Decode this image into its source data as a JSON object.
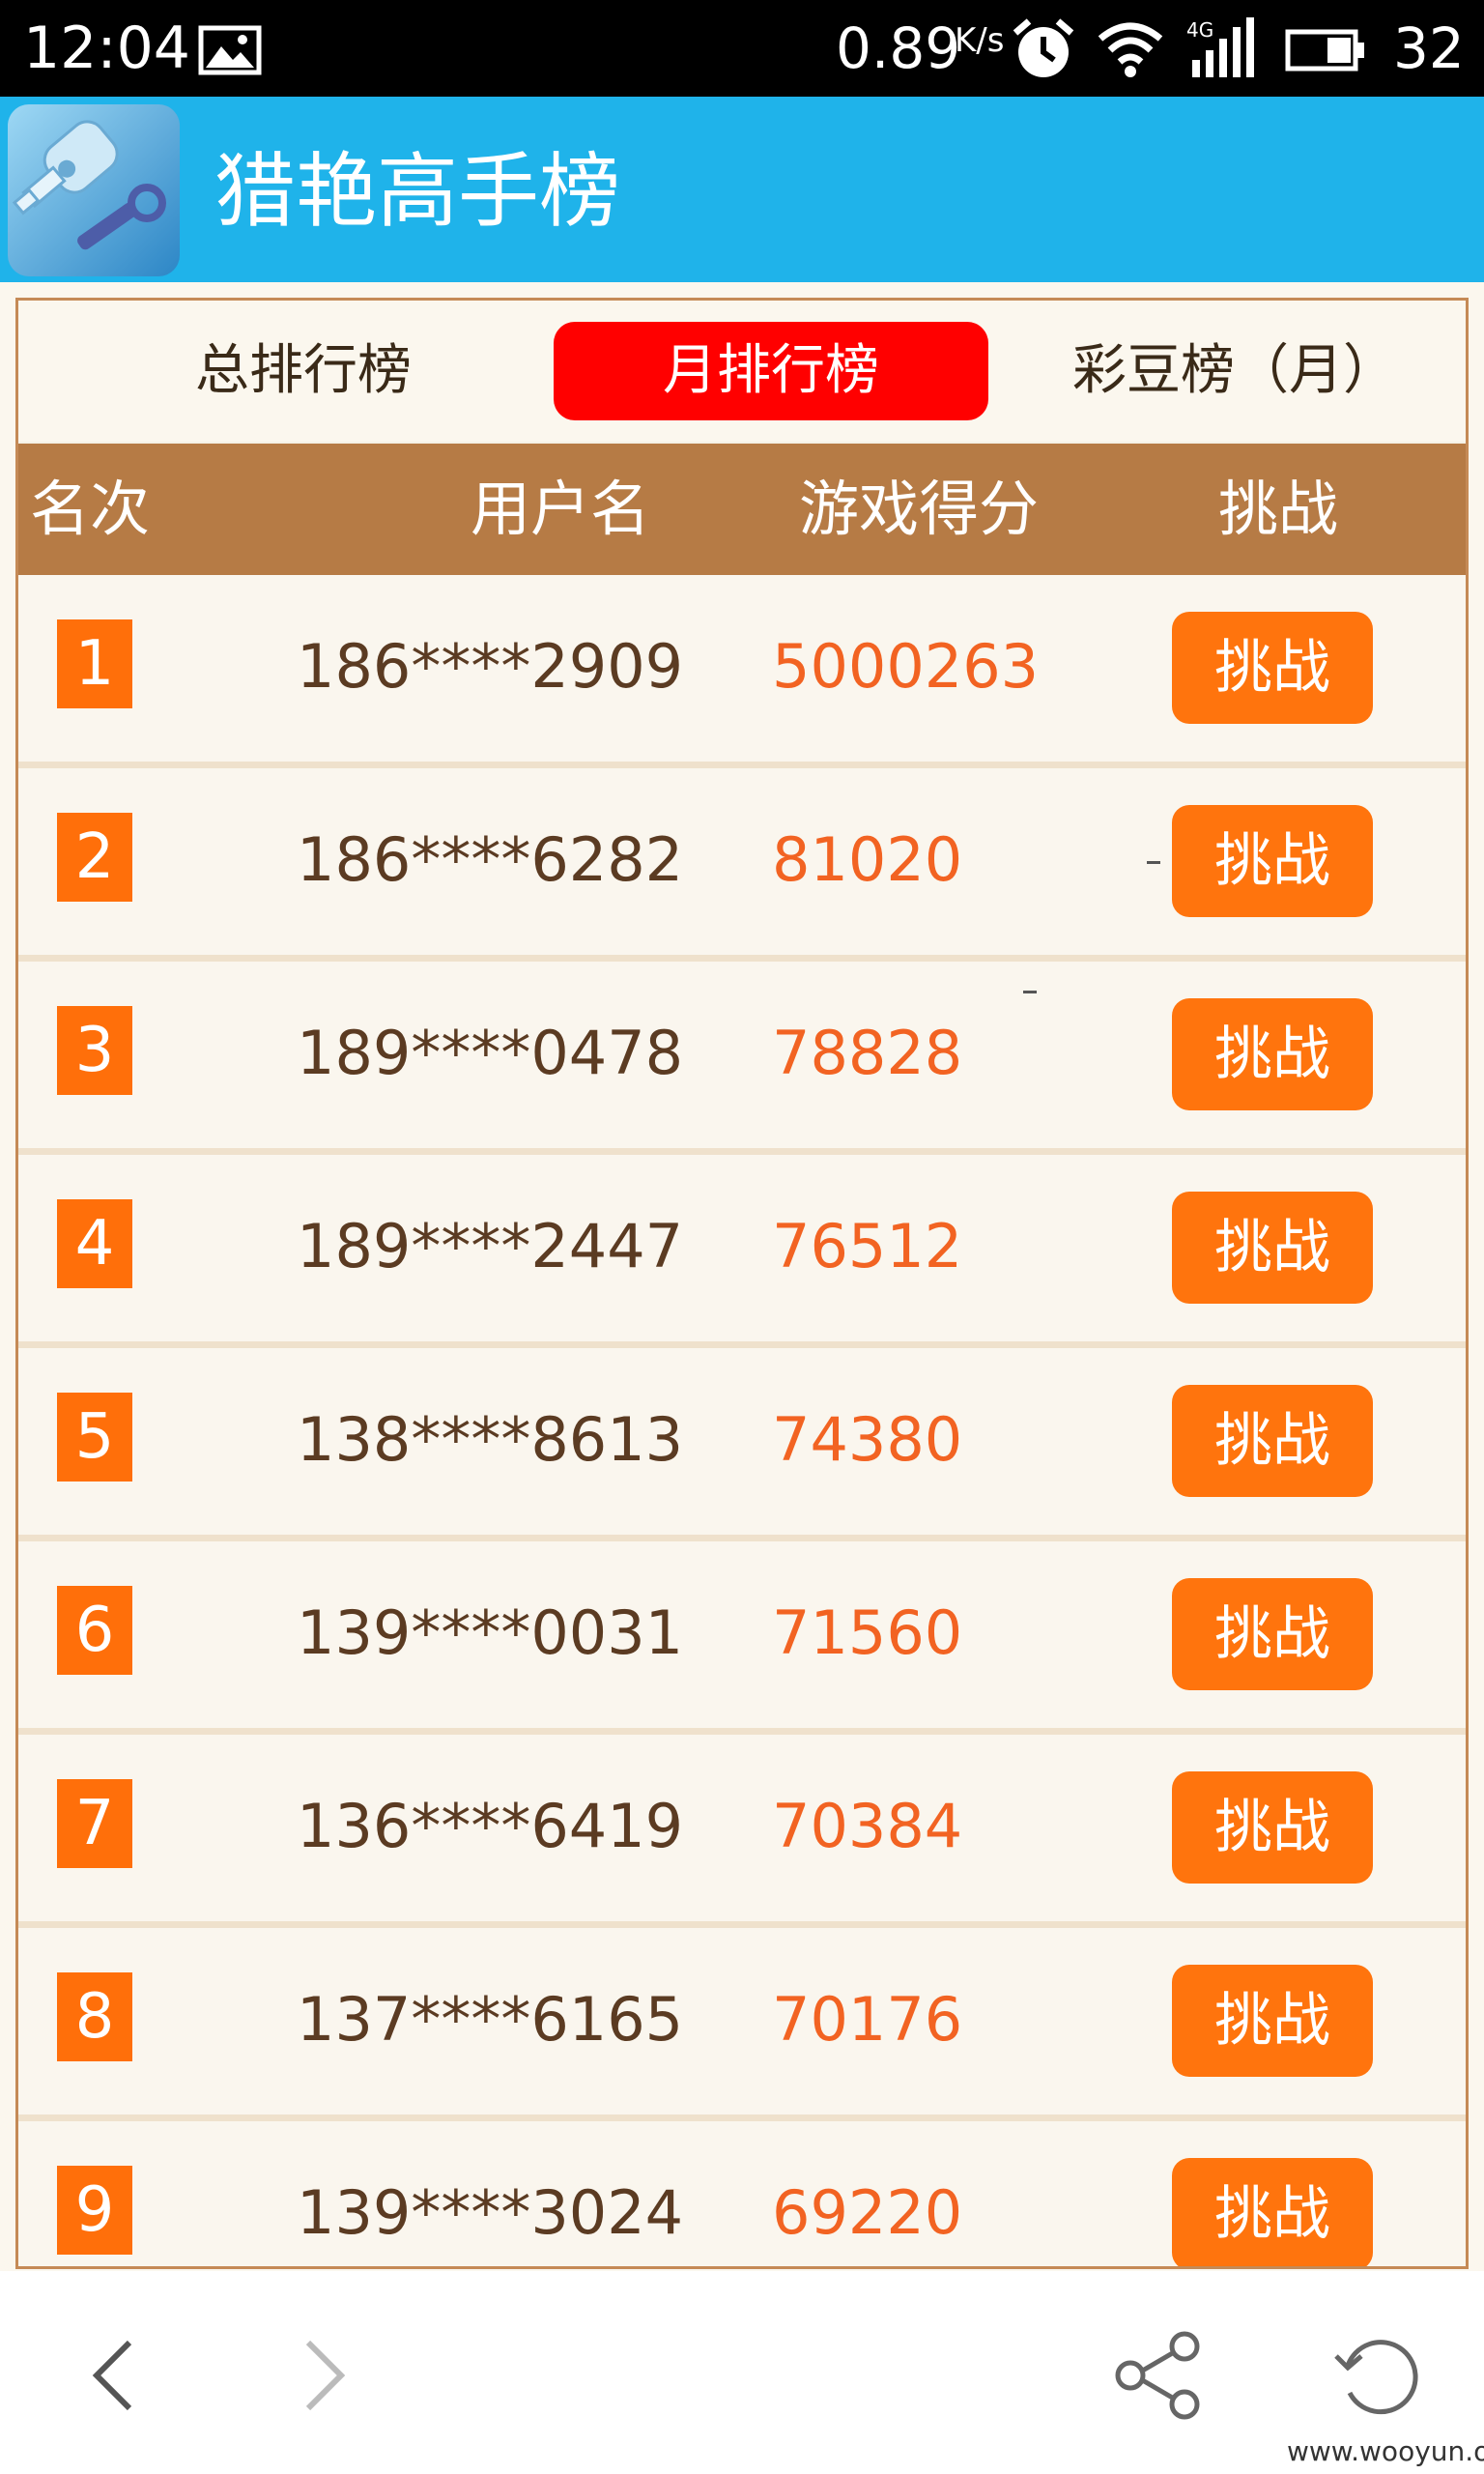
{
  "status_bar": {
    "time": "12:04",
    "speed": "0.89",
    "speed_unit": "K/s",
    "network": "4G",
    "battery": "32",
    "icons": [
      "gallery-icon",
      "alarm-icon",
      "wifi-icon",
      "signal-icon",
      "battery-icon"
    ]
  },
  "app": {
    "title": "猎艳高手榜",
    "header_color": "#1fb3ea",
    "icon": "key-wrench-app-icon"
  },
  "tabs": [
    {
      "label": "总排行榜",
      "active": false
    },
    {
      "label": "月排行榜",
      "active": true
    },
    {
      "label": "彩豆榜（月）",
      "active": false
    }
  ],
  "table": {
    "headers": {
      "rank": "名次",
      "user": "用户名",
      "score": "游戏得分",
      "challenge": "挑战"
    },
    "rows": [
      {
        "rank": "1",
        "user": "186****2909",
        "score": "5000263",
        "button": "挑战"
      },
      {
        "rank": "2",
        "user": "186****6282",
        "score": "81020",
        "button": "挑战"
      },
      {
        "rank": "3",
        "user": "189****0478",
        "score": "78828",
        "button": "挑战"
      },
      {
        "rank": "4",
        "user": "189****2447",
        "score": "76512",
        "button": "挑战"
      },
      {
        "rank": "5",
        "user": "138****8613",
        "score": "74380",
        "button": "挑战"
      },
      {
        "rank": "6",
        "user": "139****0031",
        "score": "71560",
        "button": "挑战"
      },
      {
        "rank": "7",
        "user": "136****6419",
        "score": "70384",
        "button": "挑战"
      },
      {
        "rank": "8",
        "user": "137****6165",
        "score": "70176",
        "button": "挑战"
      },
      {
        "rank": "9",
        "user": "139****3024",
        "score": "69220",
        "button": "挑战"
      }
    ]
  },
  "colors": {
    "active_tab": "#ff0000",
    "header_row": "#b67b45",
    "accent": "#ff740d",
    "score": "#f26322"
  },
  "bottom_nav": {
    "icons": [
      "back-icon",
      "forward-icon",
      "share-icon",
      "refresh-icon"
    ]
  },
  "watermark": "www.wooyun.org"
}
